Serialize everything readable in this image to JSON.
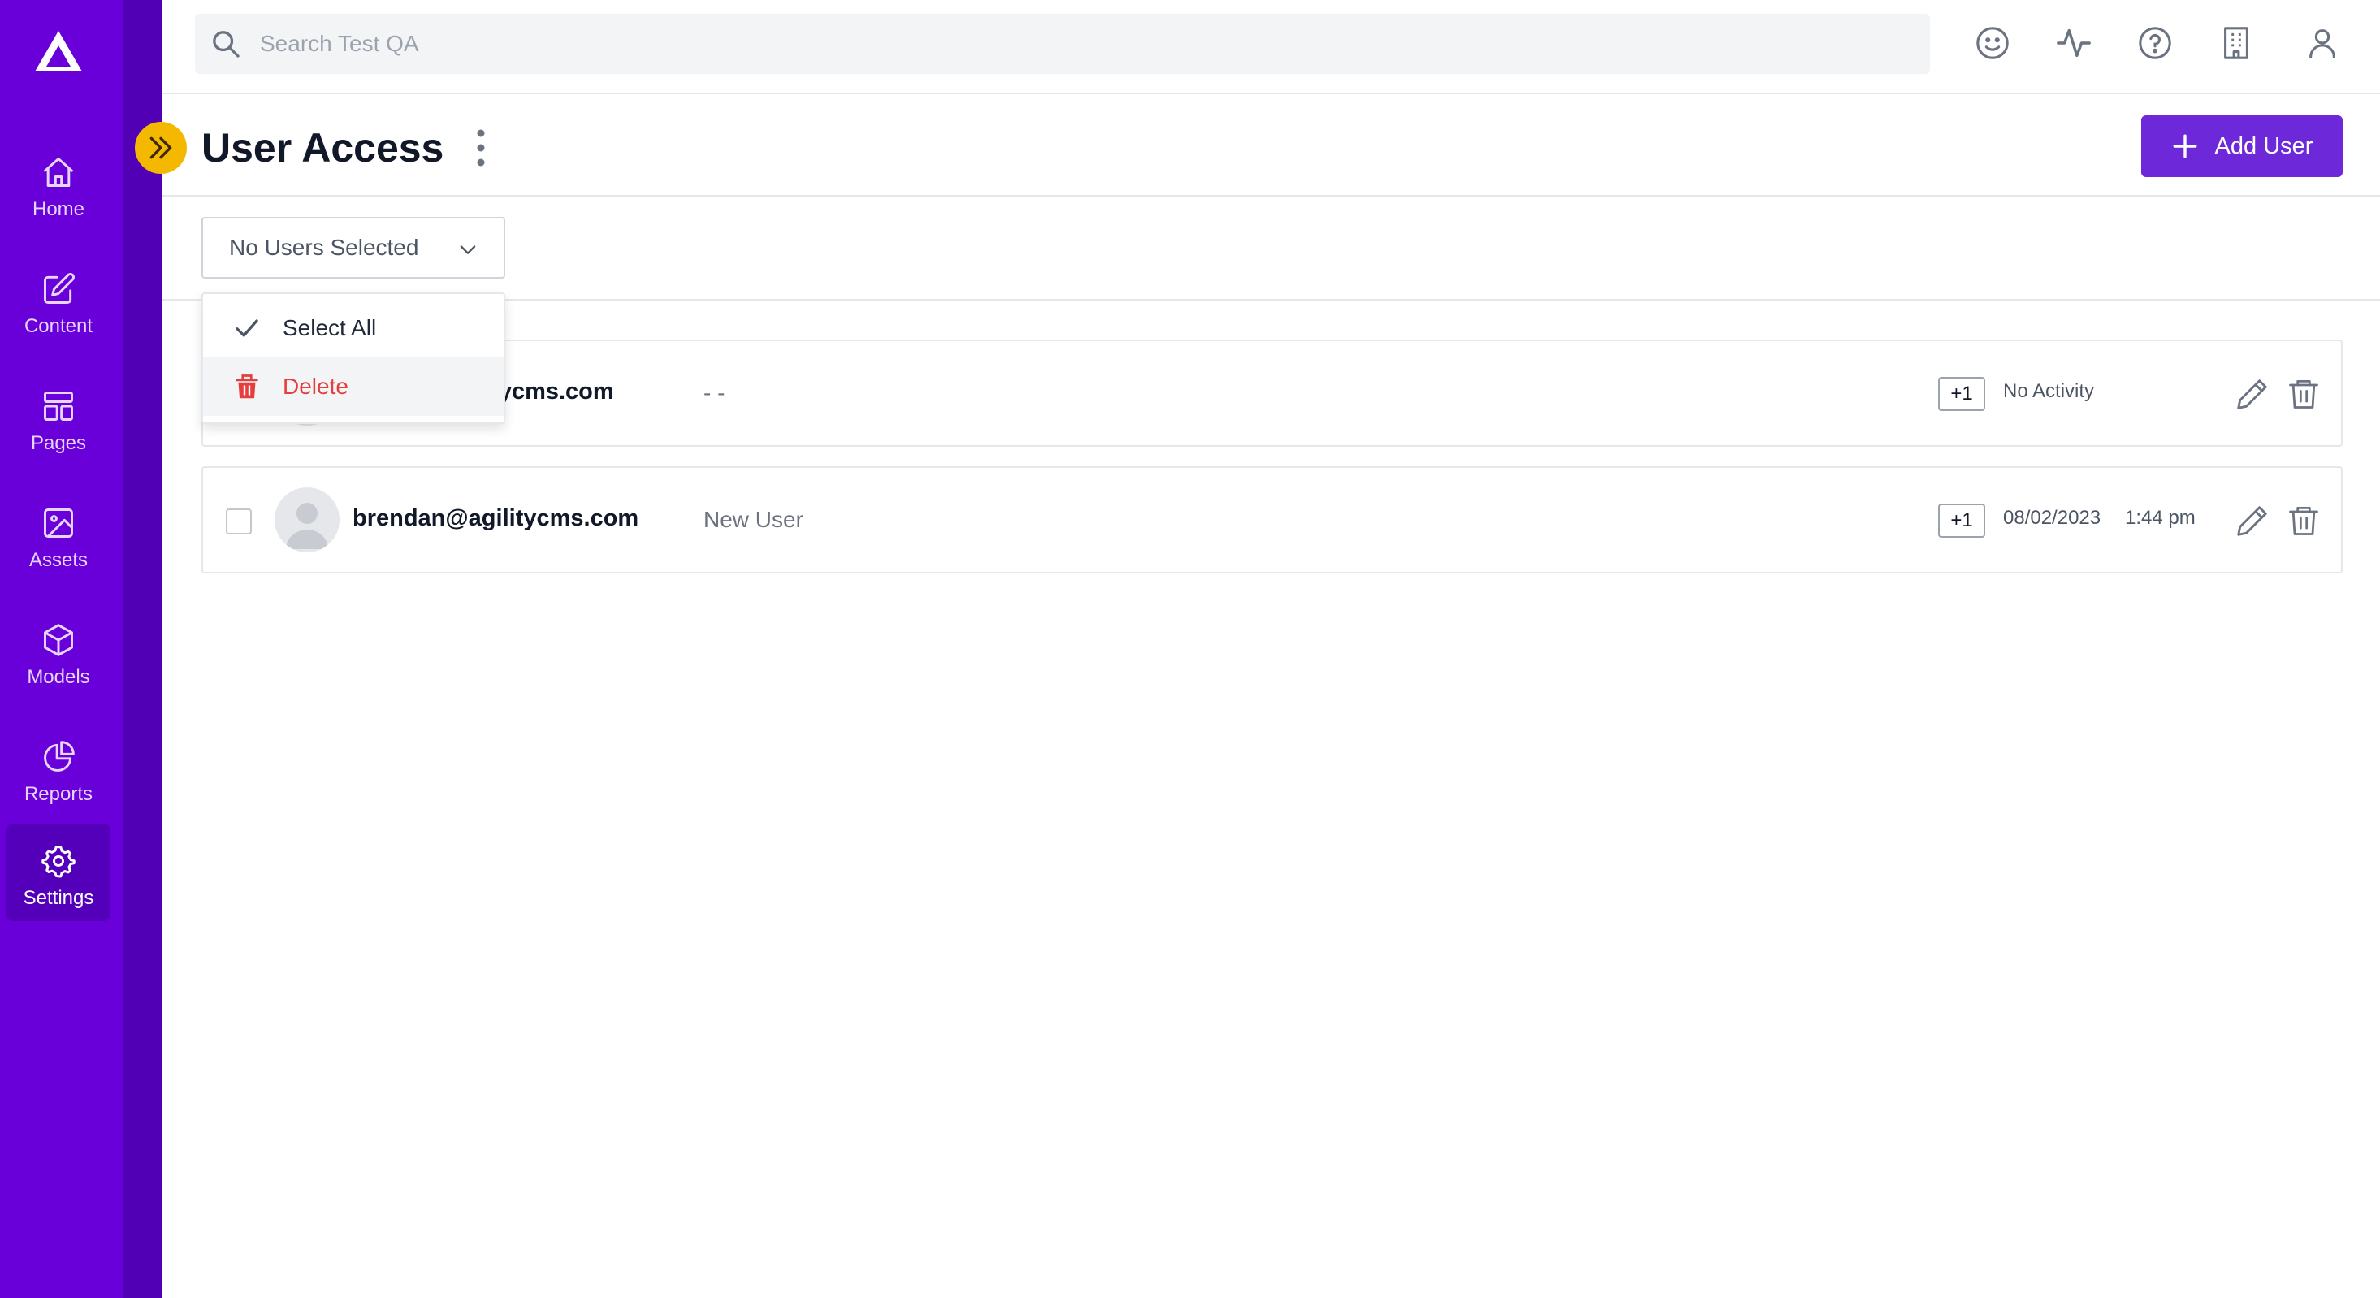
{
  "sidebar": {
    "items": [
      {
        "label": "Home",
        "icon": "home-icon"
      },
      {
        "label": "Content",
        "icon": "edit-icon"
      },
      {
        "label": "Pages",
        "icon": "layout-icon"
      },
      {
        "label": "Assets",
        "icon": "image-icon"
      },
      {
        "label": "Models",
        "icon": "cube-icon"
      },
      {
        "label": "Reports",
        "icon": "pie-chart-icon"
      },
      {
        "label": "Settings",
        "icon": "gear-icon"
      }
    ],
    "active": "Settings",
    "colors": {
      "bg": "#6a00d9",
      "strip": "#5200b5",
      "active": "#5400ba"
    }
  },
  "topbar": {
    "search_placeholder": "Search Test QA",
    "icons": [
      "smiley-icon",
      "activity-icon",
      "help-icon",
      "building-icon",
      "user-icon"
    ]
  },
  "header": {
    "title": "User Access",
    "add_user_label": "Add User",
    "accent": "#6d28d9",
    "expand_color": "#f5b800"
  },
  "filter": {
    "selected_label": "No Users Selected"
  },
  "menu": {
    "items": [
      {
        "label": "Select All",
        "icon": "check-icon"
      },
      {
        "label": "Delete",
        "icon": "trash-icon",
        "color": "#e53e3e"
      }
    ]
  },
  "users": [
    {
      "email": "brendan@agilitycms.com",
      "email_visible": "ilitycms.com",
      "role": "- -",
      "badge": "+1",
      "activity": "No Activity",
      "time": ""
    },
    {
      "email": "brendan@agilitycms.com",
      "role": "New User",
      "badge": "+1",
      "activity": "08/02/2023",
      "time": "1:44 pm"
    }
  ]
}
